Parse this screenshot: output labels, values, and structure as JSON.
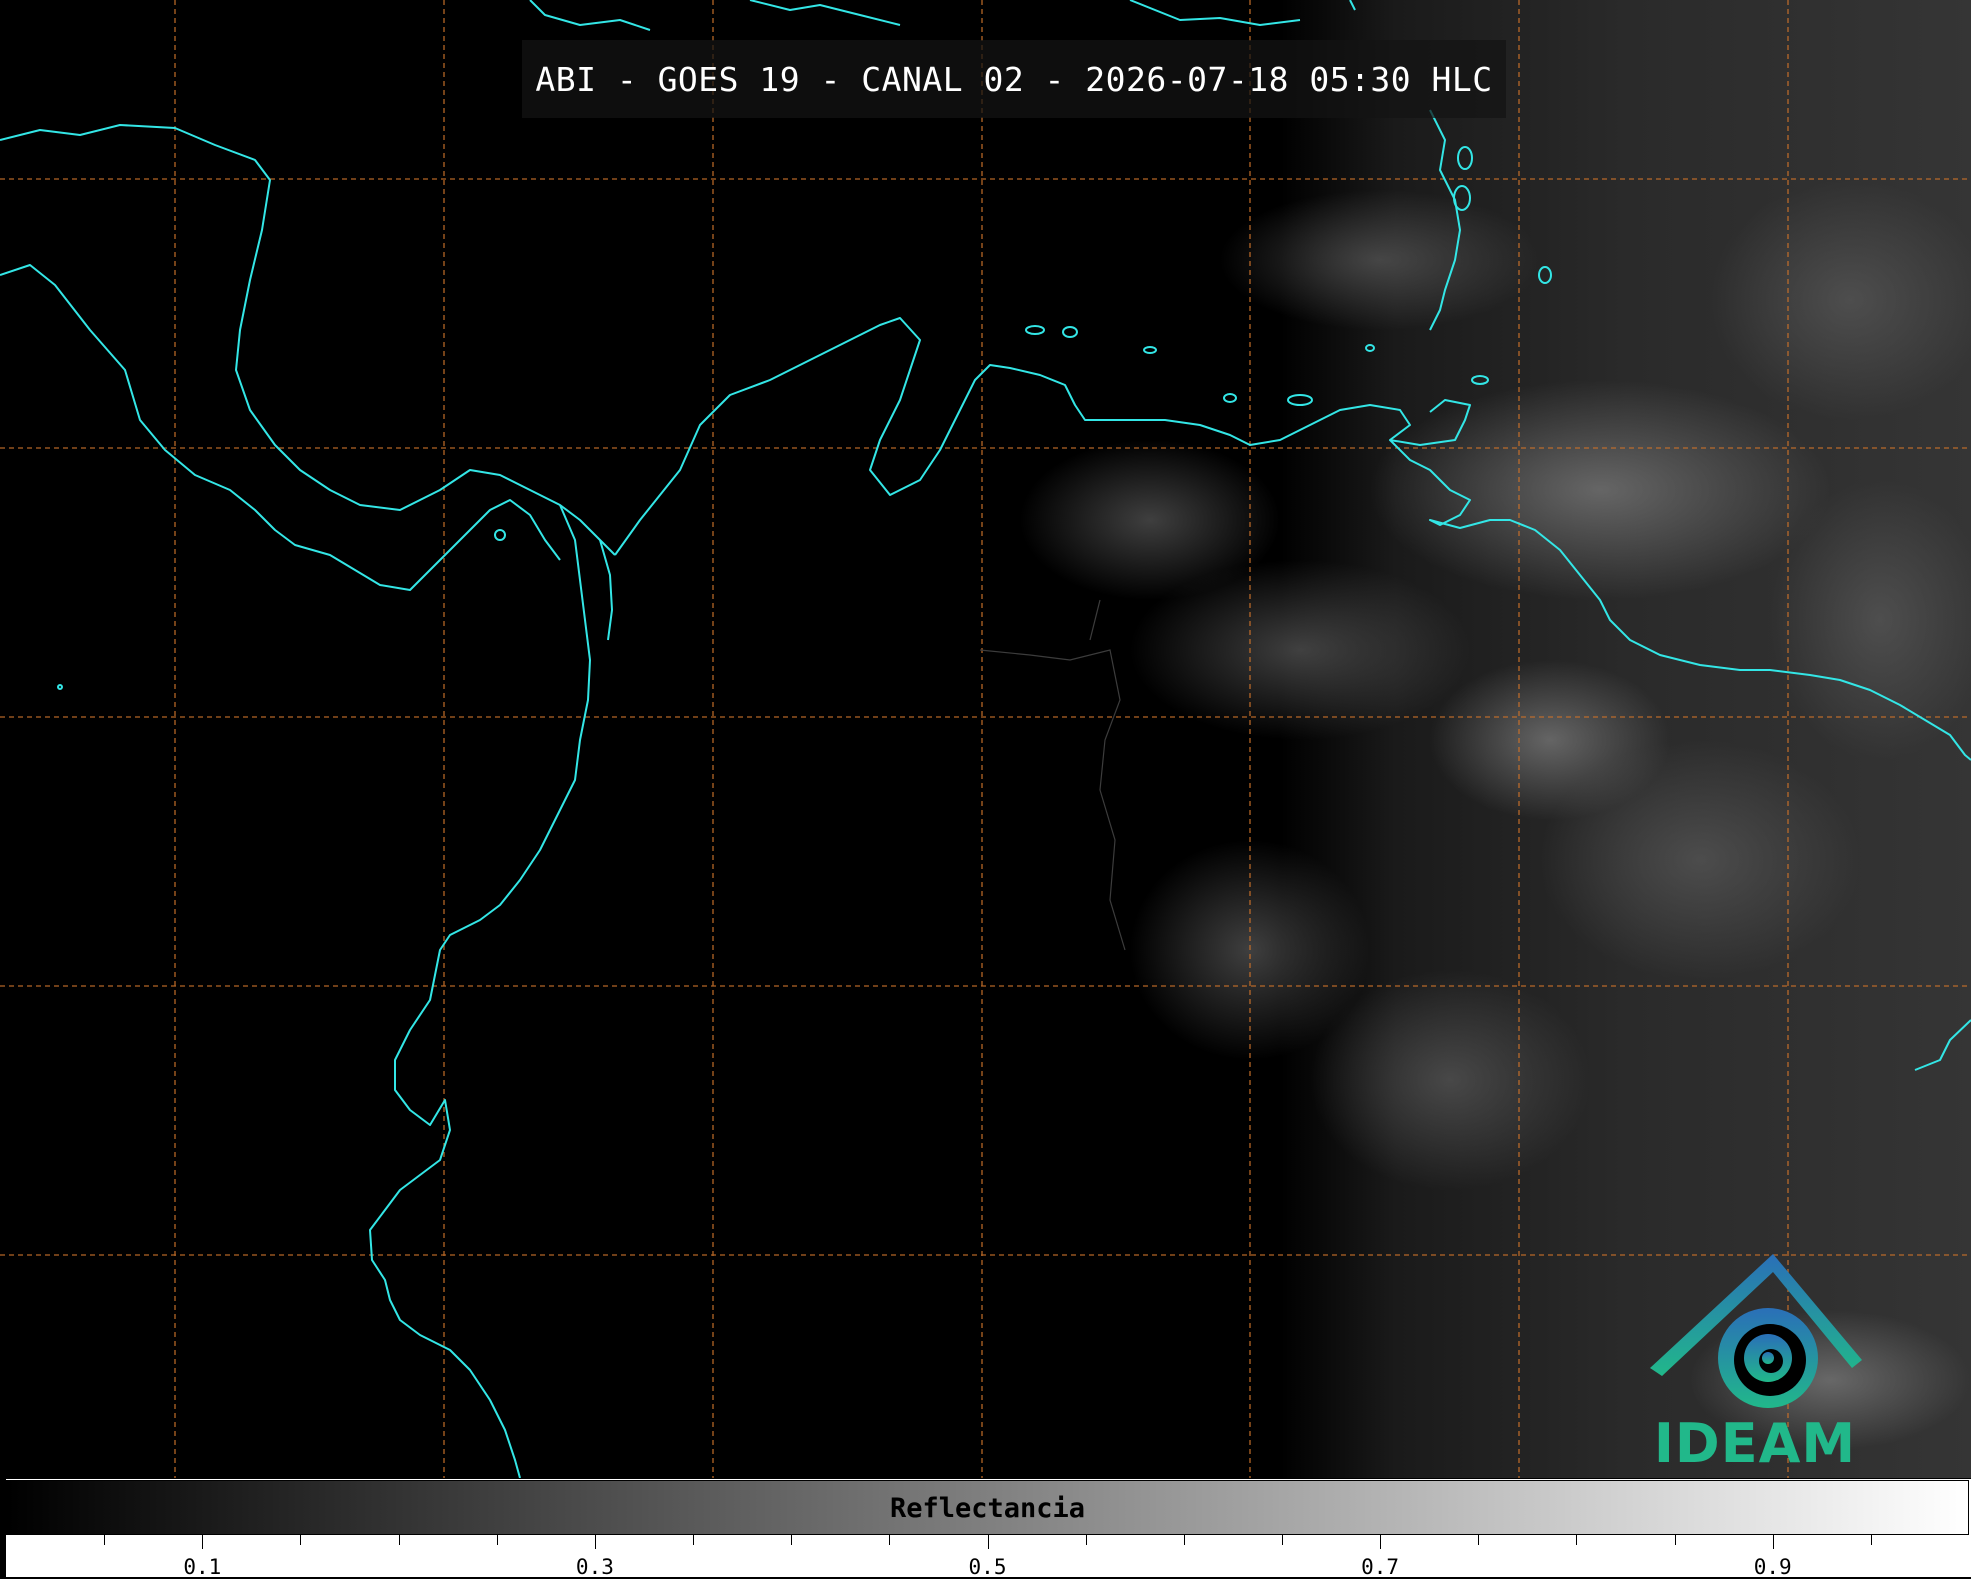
{
  "title": "ABI - GOES 19 - CANAL 02 - 2026-07-18 05:30 HLC",
  "logo": {
    "text": "IDEAM",
    "icon": "ideam-logo-icon",
    "colors": [
      "#2a6fb8",
      "#21b88a"
    ]
  },
  "colorbar": {
    "label": "Reflectancia",
    "ticks": [
      "0.1",
      "0.3",
      "0.5",
      "0.7",
      "0.9"
    ],
    "range": [
      0.0,
      1.0
    ],
    "colormap": "grayscale"
  },
  "map": {
    "coastline_color": "#33e6e6",
    "grid_color": "#c8702a",
    "background": "#000000",
    "grid_style": "dashed"
  }
}
